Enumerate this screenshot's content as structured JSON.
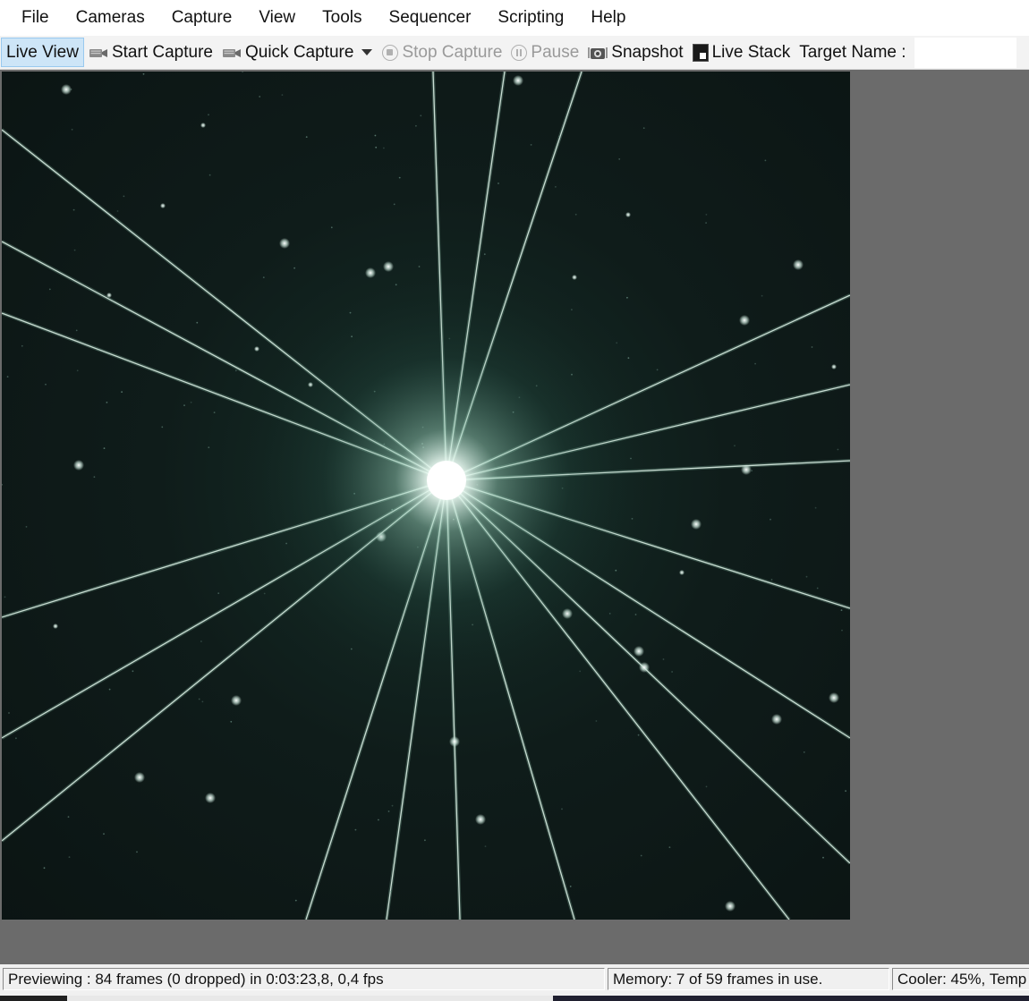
{
  "menu": {
    "items": [
      "File",
      "Cameras",
      "Capture",
      "View",
      "Tools",
      "Sequencer",
      "Scripting",
      "Help"
    ]
  },
  "toolbar": {
    "live_view": "Live View",
    "start_capture": "Start Capture",
    "quick_capture": "Quick Capture",
    "stop_capture": "Stop Capture",
    "pause": "Pause",
    "snapshot": "Snapshot",
    "live_stack": "Live Stack",
    "target_name_label": "Target Name :",
    "target_name_value": ""
  },
  "status": {
    "preview": "Previewing : 84 frames (0 dropped) in 0:03:23,8, 0,4 fps",
    "memory": "Memory: 7 of 59 frames in use.",
    "cooler": "Cooler: 45%, Temp"
  },
  "colors": {
    "sky": "#0f1a18",
    "star_core": "#ffffff",
    "spike": "#d8f0e0",
    "active_button_bg": "#cde5f7"
  }
}
